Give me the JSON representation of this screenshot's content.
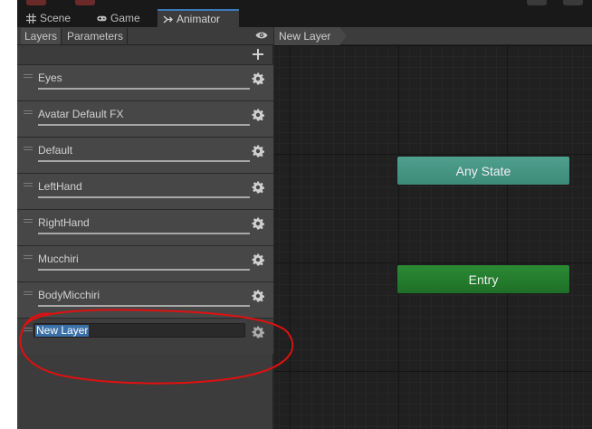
{
  "tabs": [
    {
      "label": "Scene",
      "icon": "grid-icon"
    },
    {
      "label": "Game",
      "icon": "gamepad-icon"
    },
    {
      "label": "Animator",
      "icon": "animator-icon",
      "active": true
    }
  ],
  "left_panel": {
    "subtabs": [
      {
        "label": "Layers",
        "active": true
      },
      {
        "label": "Parameters",
        "active": false
      }
    ],
    "eye_icon": "eye-icon",
    "add_icon": "plus-icon",
    "layers": [
      {
        "name": "Eyes"
      },
      {
        "name": "Avatar Default FX"
      },
      {
        "name": "Default"
      },
      {
        "name": "LeftHand"
      },
      {
        "name": "RightHand"
      },
      {
        "name": "Mucchiri"
      },
      {
        "name": "BodyMicchiri"
      }
    ],
    "editing_layer": {
      "value": "New Layer"
    }
  },
  "graph": {
    "breadcrumb": "New Layer",
    "states": {
      "any": "Any State",
      "entry": "Entry"
    }
  },
  "colors": {
    "any_state": "#479585",
    "entry": "#26802e",
    "selection": "#3b6fa8",
    "annotation": "#e01010"
  }
}
